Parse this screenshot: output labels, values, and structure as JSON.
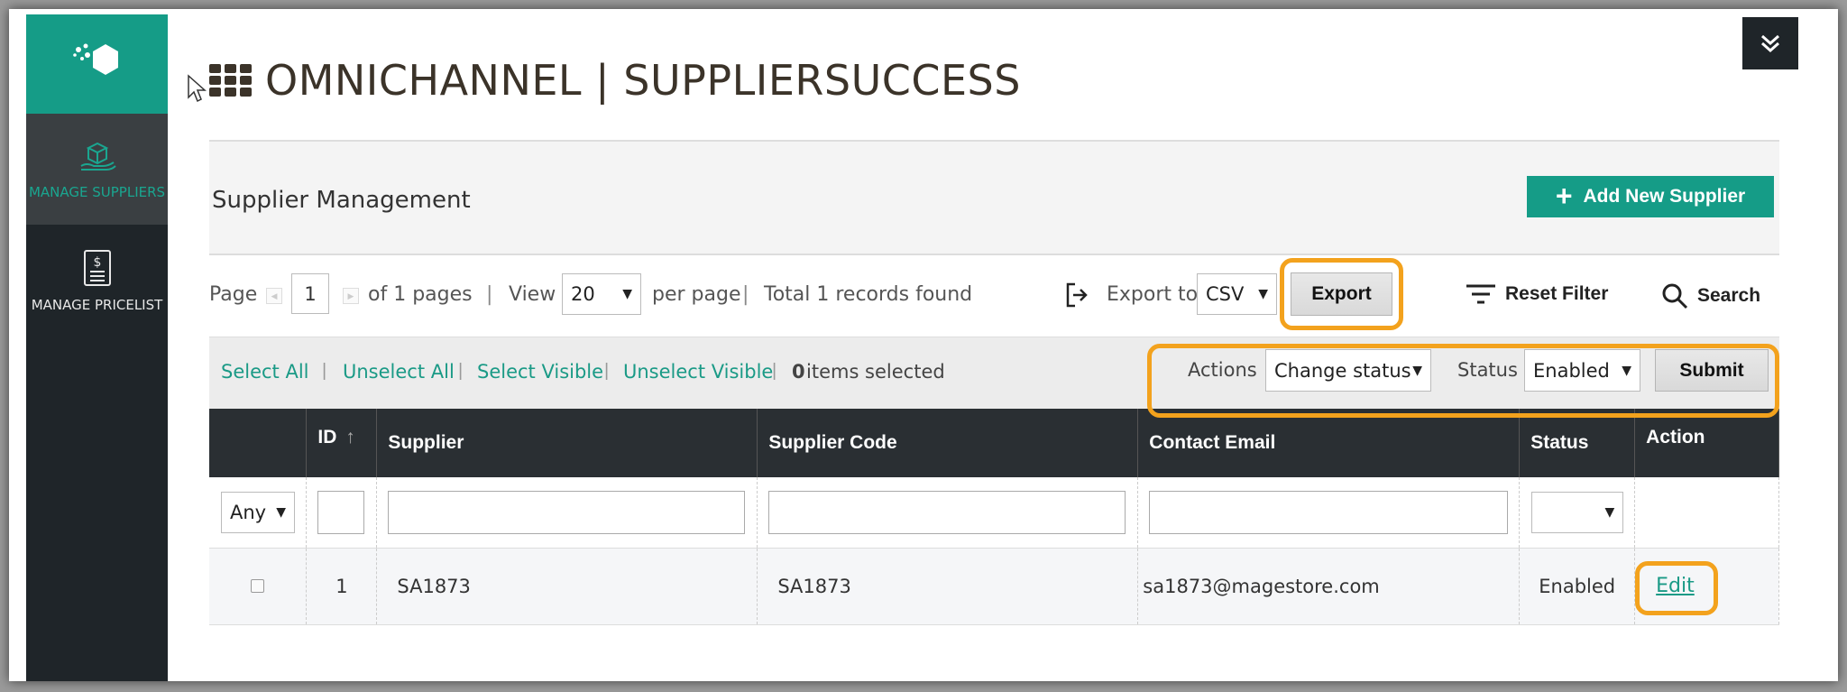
{
  "sidebar": {
    "items": [
      {
        "label": "MANAGE SUPPLIERS",
        "icon": "boxes-icon",
        "active": true
      },
      {
        "label": "MANAGE PRICELIST",
        "icon": "pricelist-icon",
        "active": false
      }
    ]
  },
  "header": {
    "title": "OMNICHANNEL | SUPPLIERSUCCESS"
  },
  "section": {
    "title": "Supplier Management",
    "add_button": "Add New Supplier"
  },
  "pager": {
    "page_label": "Page",
    "page_value": "1",
    "of_pages": "of 1 pages",
    "sep": "|",
    "view_label": "View",
    "view_value": "20",
    "per_page": "per page",
    "total": "Total 1 records found",
    "export_label": "Export to:",
    "export_format": "CSV",
    "export_button": "Export",
    "reset_filter": "Reset Filter",
    "search": "Search"
  },
  "bulk": {
    "select_all": "Select All",
    "unselect_all": "Unselect All",
    "select_visible": "Select Visible",
    "unselect_visible": "Unselect Visible",
    "sep": "|",
    "count": "0",
    "items_selected": "items selected",
    "actions_label": "Actions",
    "actions_value": "Change status",
    "status_label": "Status",
    "status_value": "Enabled",
    "submit": "Submit"
  },
  "table": {
    "columns": [
      "ID",
      "Supplier",
      "Supplier Code",
      "Contact Email",
      "Status",
      "Action"
    ],
    "filter_any": "Any",
    "rows": [
      {
        "id": "1",
        "supplier": "SA1873",
        "code": "SA1873",
        "email": "sa1873@magestore.com",
        "status": "Enabled",
        "action": "Edit"
      }
    ]
  },
  "colors": {
    "accent": "#159c87",
    "sidebar": "#1f2529",
    "highlight": "#f3a21d"
  }
}
